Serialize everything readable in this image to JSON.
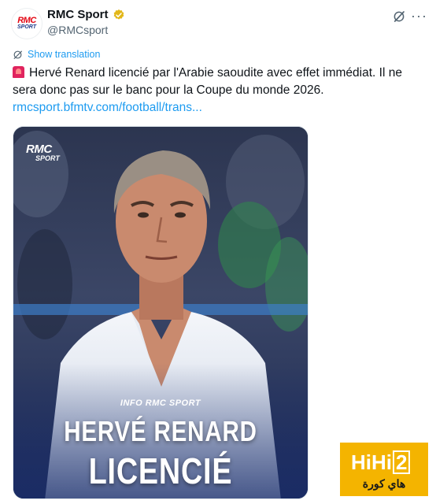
{
  "account": {
    "name": "RMC Sport",
    "handle": "@RMCsport",
    "avatar_text_top": "RMC",
    "avatar_text_bottom": "SPORT",
    "verified_color": "#e2b719"
  },
  "actions": {
    "grok_icon": "grok-icon",
    "more_label": "···"
  },
  "translation": {
    "label": "Show translation"
  },
  "tweet": {
    "emoji": "rotating-light",
    "text": "Hervé Renard licencié par l'Arabie saoudite avec effet immédiat. Il ne sera donc pas sur le banc pour la Coupe du monde 2026.",
    "link": "rmcsport.bfmtv.com/football/trans..."
  },
  "media": {
    "logo_top": "RMC",
    "logo_bottom": "SPORT",
    "info": "INFO RMC SPORT",
    "headline_1": "HERVÉ RENARD",
    "headline_2": "LICENCIÉ"
  },
  "watermark": {
    "line1_prefix": "HiHi",
    "line1_box": "2",
    "line2": "هاي كورة"
  },
  "colors": {
    "link": "#1d9bf0",
    "text": "#0f1419",
    "secondary": "#536471",
    "watermark_bg": "#f4b400"
  }
}
